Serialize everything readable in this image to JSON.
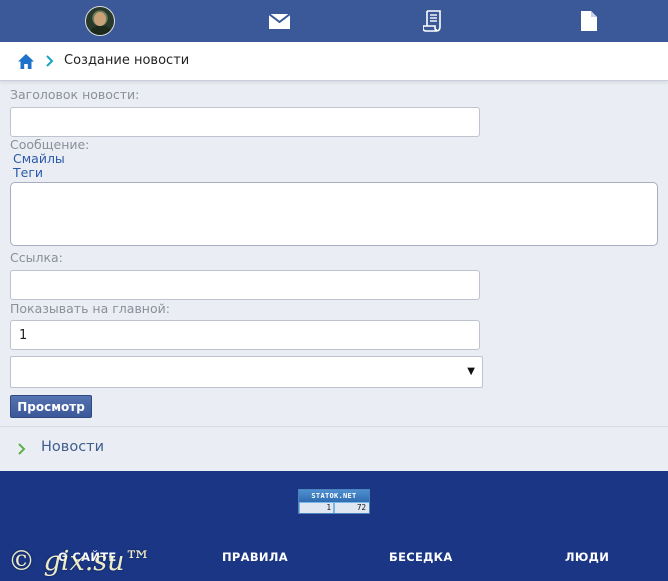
{
  "topbar": {
    "icons": [
      "avatar",
      "mail-icon",
      "scroll-icon",
      "document-icon"
    ]
  },
  "breadcrumb": {
    "title": "Создание новости"
  },
  "form": {
    "title_label": "Заголовок новости:",
    "title_value": "",
    "message_label": "Сообщение:",
    "smileys_link": "Смайлы",
    "tags_link": "Теги",
    "link_label": "Ссылка:",
    "link_value": "",
    "show_main_label": "Показывать на главной:",
    "show_main_value": "1",
    "select_value": "",
    "preview_button": "Просмотр"
  },
  "nav": {
    "news_link": "Новости"
  },
  "footer": {
    "counter": {
      "head": "STATOK.NET",
      "left": "1",
      "right": "72"
    },
    "links": [
      "О САЙТЕ",
      "ПРАВИЛА",
      "БЕСЕДКА",
      "ЛЮДИ"
    ],
    "copyright": "© gix.su™"
  },
  "colors": {
    "topbar": "#3b5898",
    "footer": "#1a3684",
    "background": "#ebedf5"
  }
}
